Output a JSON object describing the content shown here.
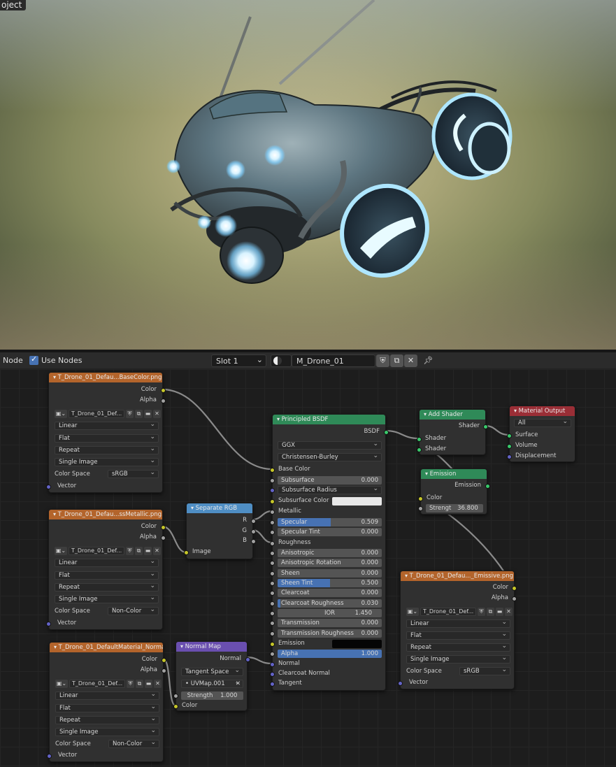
{
  "viewport": {
    "mode_label": "oject"
  },
  "header": {
    "editor_label": "Node",
    "use_nodes_label": "Use Nodes",
    "slot": "Slot 1",
    "material_name": "M_Drone_01"
  },
  "nodes": {
    "tex_base": {
      "title": "T_Drone_01_Defau...BaseColor.png.001",
      "out_color": "Color",
      "out_alpha": "Alpha",
      "image": "T_Drone_01_Def...",
      "interp": "Linear",
      "proj": "Flat",
      "ext": "Repeat",
      "source": "Single Image",
      "cs_label": "Color Space",
      "cs": "sRGB",
      "vector": "Vector"
    },
    "tex_metal": {
      "title": "T_Drone_01_Defau...ssMetallic.png.001",
      "out_color": "Color",
      "out_alpha": "Alpha",
      "image": "T_Drone_01_Def...",
      "interp": "Linear",
      "proj": "Flat",
      "ext": "Repeat",
      "source": "Single Image",
      "cs_label": "Color Space",
      "cs": "Non-Color",
      "vector": "Vector"
    },
    "tex_normal": {
      "title": "T_Drone_01_DefaultMaterial_Normal.p...",
      "out_color": "Color",
      "out_alpha": "Alpha",
      "image": "T_Drone_01_Def...",
      "interp": "Linear",
      "proj": "Flat",
      "ext": "Repeat",
      "source": "Single Image",
      "cs_label": "Color Space",
      "cs": "Non-Color",
      "vector": "Vector"
    },
    "tex_emissive": {
      "title": "T_Drone_01_Defau..._Emissive.png.001",
      "out_color": "Color",
      "out_alpha": "Alpha",
      "image": "T_Drone_01_Def...",
      "interp": "Linear",
      "proj": "Flat",
      "ext": "Repeat",
      "source": "Single Image",
      "cs_label": "Color Space",
      "cs": "sRGB",
      "vector": "Vector"
    },
    "separate_rgb": {
      "title": "Separate RGB",
      "r": "R",
      "g": "G",
      "b": "B",
      "image": "Image"
    },
    "normal_map": {
      "title": "Normal Map",
      "out": "Normal",
      "space": "Tangent Space",
      "uv": "UVMap.001",
      "strength_label": "Strength",
      "strength": "1.000",
      "color": "Color"
    },
    "bsdf": {
      "title": "Principled BSDF",
      "out": "BSDF",
      "distribution": "GGX",
      "subsurface_method": "Christensen-Burley",
      "base_color": "Base Color",
      "subsurface": {
        "label": "Subsurface",
        "value": "0.000"
      },
      "subsurface_radius": "Subsurface Radius",
      "subsurface_color": "Subsurface Color",
      "metallic": "Metallic",
      "specular": {
        "label": "Specular",
        "value": "0.509",
        "fill": 0.509
      },
      "specular_tint": {
        "label": "Specular Tint",
        "value": "0.000"
      },
      "roughness": "Roughness",
      "anisotropic": {
        "label": "Anisotropic",
        "value": "0.000"
      },
      "anisotropic_rotation": {
        "label": "Anisotropic Rotation",
        "value": "0.000"
      },
      "sheen": {
        "label": "Sheen",
        "value": "0.000"
      },
      "sheen_tint": {
        "label": "Sheen Tint",
        "value": "0.500",
        "fill": 0.5
      },
      "clearcoat": {
        "label": "Clearcoat",
        "value": "0.000"
      },
      "clearcoat_roughness": {
        "label": "Clearcoat Roughness",
        "value": "0.030",
        "fill": 0.03
      },
      "ior": {
        "label": "IOR",
        "value": "1.450"
      },
      "transmission": {
        "label": "Transmission",
        "value": "0.000"
      },
      "transmission_roughness": {
        "label": "Transmission Roughness",
        "value": "0.000"
      },
      "emission": "Emission",
      "alpha": {
        "label": "Alpha",
        "value": "1.000",
        "fill": 1.0
      },
      "normal": "Normal",
      "clearcoat_normal": "Clearcoat Normal",
      "tangent": "Tangent"
    },
    "add_shader": {
      "title": "Add Shader",
      "out": "Shader",
      "in1": "Shader",
      "in2": "Shader"
    },
    "emission": {
      "title": "Emission",
      "out": "Emission",
      "color": "Color",
      "strength_label": "Strengt",
      "strength": "36.800"
    },
    "material_output": {
      "title": "Material Output",
      "target": "All",
      "surface": "Surface",
      "volume": "Volume",
      "displacement": "Displacement"
    }
  },
  "colors": {
    "texture_header": "#b3642b",
    "shader_header": "#2f8a58",
    "converter_header": "#4f8ec4",
    "vector_header": "#6a4fb0",
    "output_header": "#9a2e36",
    "slider_fill": "#4772b3"
  }
}
